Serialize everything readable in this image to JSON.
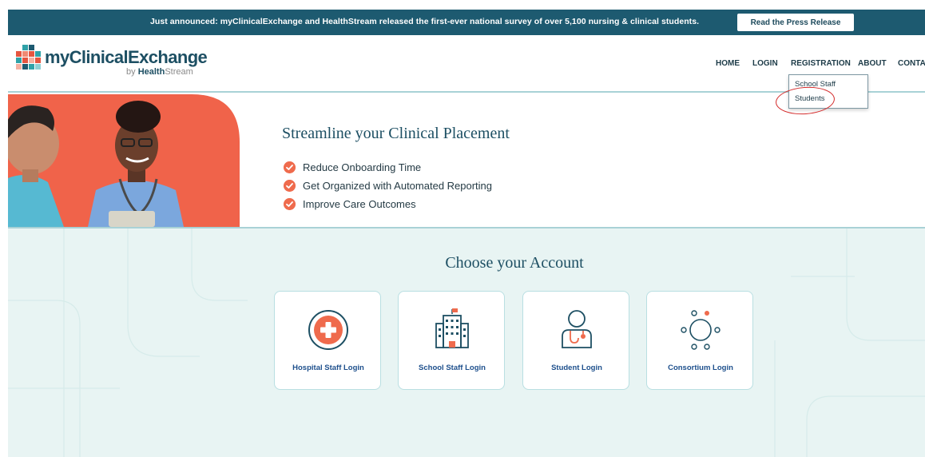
{
  "announcement": {
    "text": "Just announced: myClinicalExchange and HealthStream released the first-ever national survey of over 5,100 nursing & clinical students.",
    "button_label": "Read the Press Release"
  },
  "brand": {
    "name": "myClinicalExchange",
    "by_prefix": "by",
    "by_bold": "Health",
    "by_rest": "Stream"
  },
  "nav": {
    "items": [
      {
        "label": "HOME"
      },
      {
        "label": "LOGIN"
      },
      {
        "label": "REGISTRATION"
      },
      {
        "label": "ABOUT"
      },
      {
        "label": "CONTAC"
      }
    ]
  },
  "registration_menu": {
    "items": [
      {
        "label": "School Staff"
      },
      {
        "label": "Students"
      }
    ]
  },
  "hero": {
    "title": "Streamline your Clinical Placement",
    "benefits": [
      "Reduce Onboarding Time",
      "Get Organized with Automated Reporting",
      "Improve Care Outcomes"
    ]
  },
  "accounts": {
    "title": "Choose your Account",
    "cards": [
      {
        "label": "Hospital Staff Login",
        "icon": "hospital-cross-icon"
      },
      {
        "label": "School Staff Login",
        "icon": "school-building-icon"
      },
      {
        "label": "Student Login",
        "icon": "student-stethoscope-icon"
      },
      {
        "label": "Consortium Login",
        "icon": "consortium-network-icon"
      }
    ]
  },
  "colors": {
    "primary": "#1d5a70",
    "accent": "#ef6b4d",
    "section_bg": "#e8f4f3",
    "annotation": "#d42c2c"
  }
}
